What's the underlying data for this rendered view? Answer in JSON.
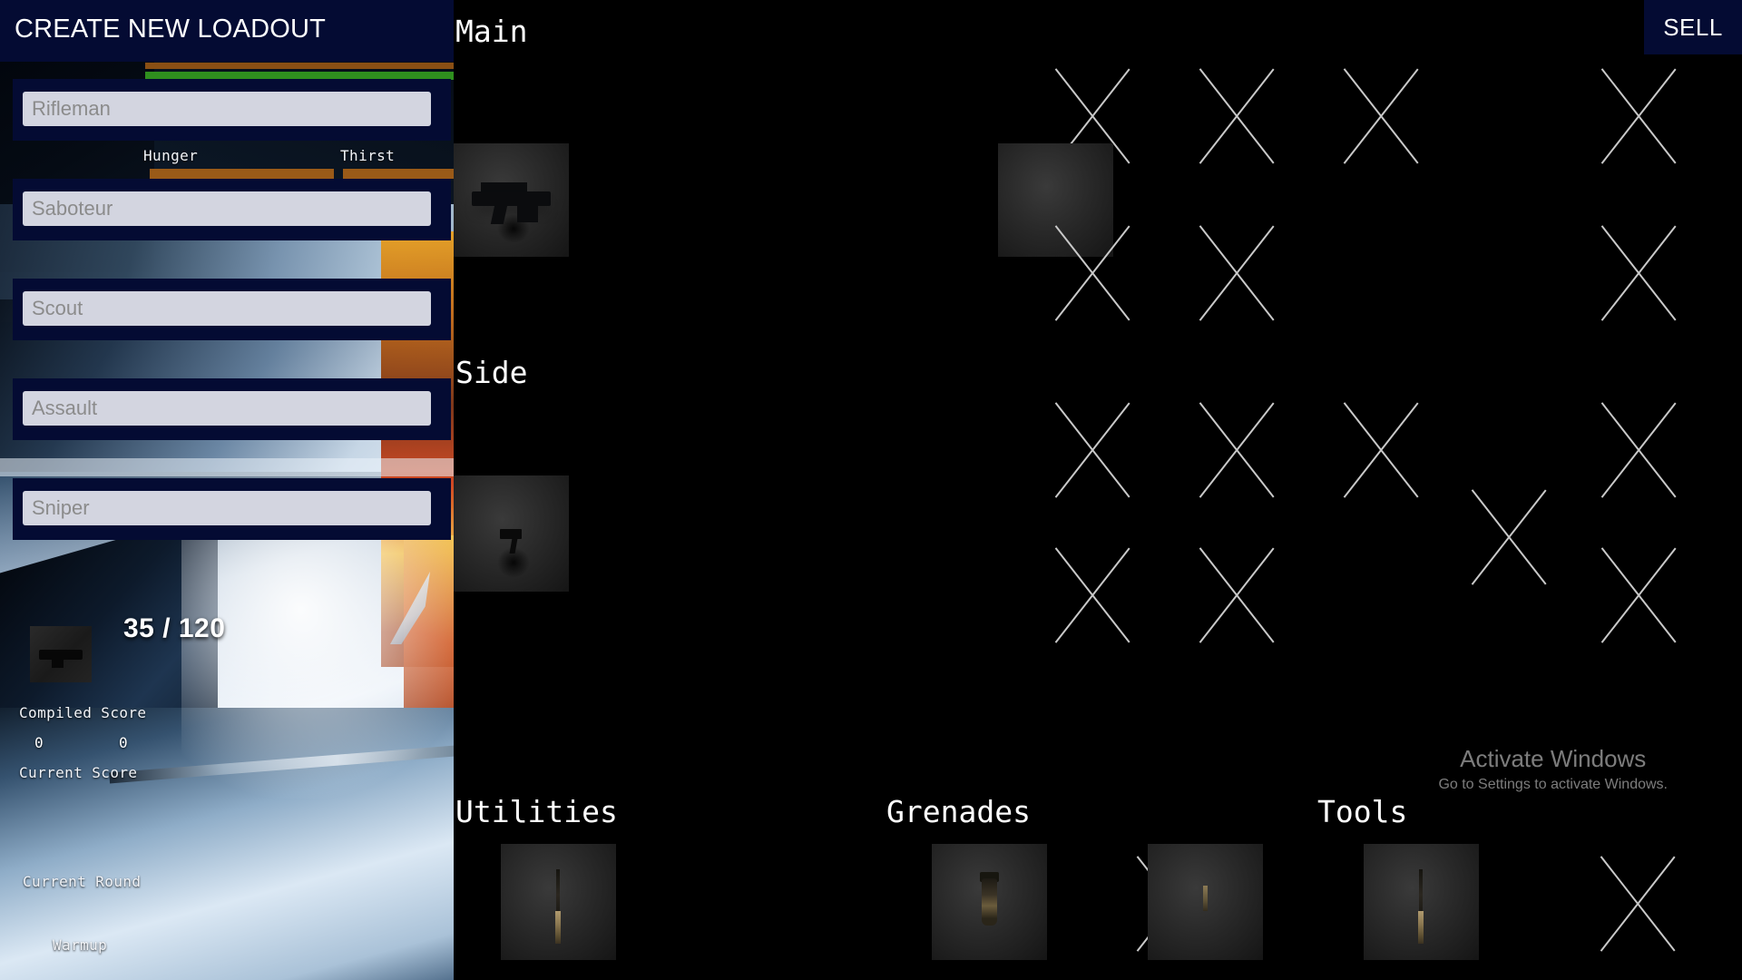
{
  "loadout_panel": {
    "title": "CREATE NEW LOADOUT",
    "rows": [
      {
        "placeholder": "Rifleman",
        "value": ""
      },
      {
        "placeholder": "Saboteur",
        "value": ""
      },
      {
        "placeholder": "Scout",
        "value": ""
      },
      {
        "placeholder": "Assault",
        "value": ""
      },
      {
        "placeholder": "Sniper",
        "value": ""
      }
    ]
  },
  "hud": {
    "hunger_label": "Hunger",
    "thirst_label": "Thirst",
    "ammo": "35 / 120",
    "compiled_score_label": "Compiled Score",
    "compiled_score_value": "0",
    "current_score_label": "Current Score",
    "current_score_value": "0",
    "current_round_label": "Current Round",
    "current_round_value": "Warmup",
    "colors": {
      "health_bar": "#2f8f1e",
      "hunger_bar": "#9a5a18",
      "thirst_bar": "#9a5a18",
      "panel_navy": "#040b33"
    }
  },
  "inventory": {
    "sell_label": "SELL",
    "sections": [
      {
        "title": "Main",
        "rows": [
          [
            {
              "state": "filled",
              "item": "assault-rifle"
            },
            {
              "state": "empty"
            },
            {
              "state": "empty"
            },
            {
              "state": "empty"
            },
            {
              "state": "filled",
              "item": "smg"
            },
            {
              "state": "empty"
            },
            {
              "state": "empty"
            },
            {
              "state": "empty"
            }
          ],
          [
            {
              "state": "none"
            },
            {
              "state": "empty"
            },
            {
              "state": "empty"
            },
            {
              "state": "none"
            },
            {
              "state": "none"
            },
            {
              "state": "empty"
            },
            {
              "state": "empty"
            },
            {
              "state": "none"
            }
          ]
        ]
      },
      {
        "title": "Side",
        "rows": [
          [
            {
              "state": "none"
            },
            {
              "state": "empty"
            },
            {
              "state": "empty"
            },
            {
              "state": "empty"
            },
            {
              "state": "none"
            },
            {
              "state": "empty"
            },
            {
              "state": "empty"
            },
            {
              "state": "empty"
            }
          ],
          [
            {
              "state": "filled",
              "item": "pistol"
            },
            {
              "state": "empty"
            },
            {
              "state": "empty"
            },
            {
              "state": "none"
            },
            {
              "state": "empty"
            },
            {
              "state": "empty"
            },
            {
              "state": "empty"
            },
            {
              "state": "none"
            }
          ]
        ]
      }
    ],
    "bottom_sections": [
      {
        "title": "Utilities",
        "slots": [
          {
            "state": "filled",
            "item": "knife"
          },
          {
            "state": "empty"
          }
        ]
      },
      {
        "title": "Grenades",
        "slots": [
          {
            "state": "filled",
            "item": "grenade"
          },
          {
            "state": "filled",
            "item": "tool-small"
          }
        ]
      },
      {
        "title": "Tools",
        "slots": [
          {
            "state": "filled",
            "item": "knife"
          },
          {
            "state": "empty"
          }
        ]
      }
    ]
  },
  "watermark": {
    "line1": "Activate Windows",
    "line2": "Go to Settings to activate Windows."
  }
}
